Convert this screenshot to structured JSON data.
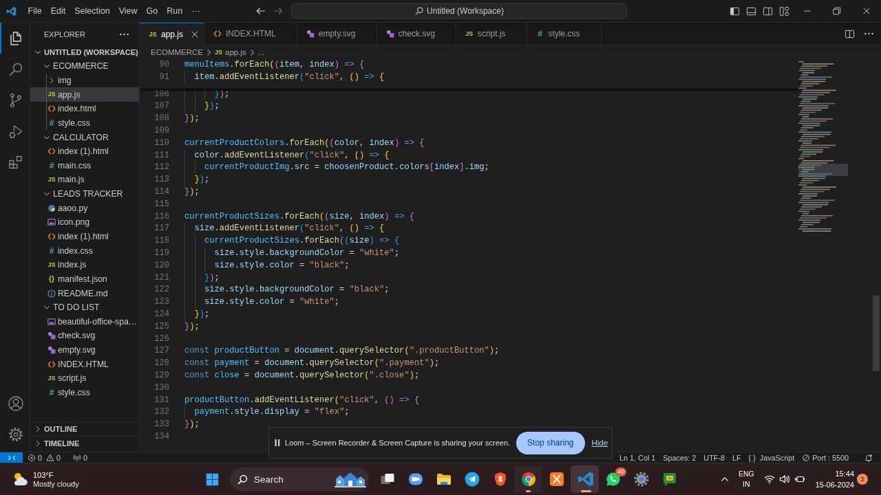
{
  "title_bar": {
    "menu": [
      "File",
      "Edit",
      "Selection",
      "View",
      "Go",
      "Run",
      "···"
    ],
    "command_center": "Untitled (Workspace)"
  },
  "activity_bar": {
    "top": [
      {
        "kind": "explorer",
        "selected": true
      },
      {
        "kind": "search",
        "selected": false
      },
      {
        "kind": "scm",
        "selected": false
      },
      {
        "kind": "debug",
        "selected": false
      },
      {
        "kind": "extensions",
        "selected": false
      }
    ],
    "bottom": [
      {
        "kind": "accounts"
      },
      {
        "kind": "manage"
      }
    ]
  },
  "sidebar": {
    "title": "EXPLORER",
    "sections": [
      {
        "title": "UNTITLED (WORKSPACE)",
        "expanded": true,
        "tree": [
          {
            "name": "ECOMMERCE",
            "kind": "folder",
            "expanded": true,
            "selected": false,
            "children": [
              {
                "name": "img",
                "kind": "folder",
                "expanded": false,
                "selected": false
              },
              {
                "name": "app.js",
                "kind": "js",
                "glyph": "JS",
                "selected": true
              },
              {
                "name": "index.html",
                "kind": "html",
                "selected": false
              },
              {
                "name": "style.css",
                "kind": "css",
                "glyph": "#",
                "selected": false
              }
            ]
          },
          {
            "name": "CALCULATOR",
            "kind": "folder",
            "expanded": true,
            "selected": false,
            "children": [
              {
                "name": "index (1).html",
                "kind": "html",
                "selected": false
              },
              {
                "name": "main.css",
                "kind": "css",
                "glyph": "#",
                "selected": false
              },
              {
                "name": "main.js",
                "kind": "js",
                "glyph": "JS",
                "selected": false
              }
            ]
          },
          {
            "name": "LEADS TRACKER",
            "kind": "folder",
            "expanded": true,
            "selected": false,
            "children": [
              {
                "name": "aaoo.py",
                "kind": "python",
                "selected": false
              },
              {
                "name": "icon.png",
                "kind": "image",
                "selected": false
              },
              {
                "name": "index (1).html",
                "kind": "html",
                "selected": false
              },
              {
                "name": "index.css",
                "kind": "css",
                "glyph": "#",
                "selected": false
              },
              {
                "name": "index.js",
                "kind": "js",
                "glyph": "JS",
                "selected": false
              },
              {
                "name": "manifest.json",
                "kind": "json",
                "glyph": "{}",
                "selected": false
              },
              {
                "name": "README.md",
                "kind": "markdown",
                "selected": false
              }
            ]
          },
          {
            "name": "TO DO LIST",
            "kind": "folder",
            "expanded": true,
            "selected": false,
            "children": [
              {
                "name": "beautiful-office-spa…",
                "kind": "image",
                "selected": false
              },
              {
                "name": "check.svg",
                "kind": "svg",
                "selected": false
              },
              {
                "name": "empty.svg",
                "kind": "svg",
                "selected": false
              },
              {
                "name": "INDEX.HTML",
                "kind": "html",
                "selected": false
              },
              {
                "name": "script.js",
                "kind": "js",
                "glyph": "JS",
                "selected": false
              },
              {
                "name": "style.css",
                "kind": "css",
                "glyph": "#",
                "selected": false
              }
            ]
          }
        ]
      },
      {
        "title": "OUTLINE",
        "expanded": false
      },
      {
        "title": "TIMELINE",
        "expanded": false
      }
    ]
  },
  "tabs": [
    {
      "label": "app.js",
      "kind": "js",
      "glyph": "JS",
      "selected": true
    },
    {
      "label": "INDEX.HTML",
      "kind": "html",
      "selected": false
    },
    {
      "label": "empty.svg",
      "kind": "svg",
      "selected": false
    },
    {
      "label": "check.svg",
      "kind": "svg",
      "selected": false
    },
    {
      "label": "script.js",
      "kind": "js",
      "glyph": "JS",
      "selected": false
    },
    {
      "label": "style.css",
      "kind": "css",
      "glyph": "#",
      "selected": false
    }
  ],
  "breadcrumbs": [
    {
      "label": "ECOMMERCE"
    },
    {
      "label": "app.js",
      "kind": "js",
      "glyph": "JS"
    },
    {
      "label": "..."
    }
  ],
  "editor": {
    "sticky_lines": [
      {
        "number": "90",
        "tokens": [
          {
            "kind": "const",
            "text": "menuItems"
          },
          {
            "kind": "plain",
            "text": "."
          },
          {
            "kind": "func",
            "text": "forEach"
          },
          {
            "kind": "bracket1",
            "text": "("
          },
          {
            "kind": "bracket2",
            "text": "("
          },
          {
            "kind": "var",
            "text": "item"
          },
          {
            "kind": "plain",
            "text": ", "
          },
          {
            "kind": "var",
            "text": "index"
          },
          {
            "kind": "bracket2",
            "text": ")"
          },
          {
            "kind": "keyword",
            "text": " => "
          },
          {
            "kind": "bracket2",
            "text": "{"
          }
        ]
      },
      {
        "number": "91",
        "tokens": [
          {
            "kind": "var",
            "text": "  item"
          },
          {
            "kind": "plain",
            "text": "."
          },
          {
            "kind": "func",
            "text": "addEventListener"
          },
          {
            "kind": "bracket3",
            "text": "("
          },
          {
            "kind": "string",
            "text": "\"click\""
          },
          {
            "kind": "plain",
            "text": ", "
          },
          {
            "kind": "bracket1",
            "text": "()"
          },
          {
            "kind": "keyword",
            "text": " => "
          },
          {
            "kind": "bracket1",
            "text": "{"
          }
        ]
      }
    ],
    "lines": [
      {
        "number": "106",
        "tokens": [
          {
            "kind": "bracket3",
            "text": "      }"
          },
          {
            "kind": "bracket2",
            "text": ")"
          },
          {
            "kind": "plain",
            "text": ";"
          }
        ]
      },
      {
        "number": "107",
        "tokens": [
          {
            "kind": "bracket1",
            "text": "    }"
          },
          {
            "kind": "bracket3",
            "text": ")"
          },
          {
            "kind": "plain",
            "text": ";"
          }
        ]
      },
      {
        "number": "108",
        "tokens": [
          {
            "kind": "bracket2",
            "text": "}"
          },
          {
            "kind": "bracket1",
            "text": ")"
          },
          {
            "kind": "plain",
            "text": ";"
          }
        ]
      },
      {
        "number": "109"
      },
      {
        "number": "110",
        "tokens": [
          {
            "kind": "const",
            "text": "currentProductColors"
          },
          {
            "kind": "plain",
            "text": "."
          },
          {
            "kind": "func",
            "text": "forEach"
          },
          {
            "kind": "bracket1",
            "text": "("
          },
          {
            "kind": "bracket2",
            "text": "("
          },
          {
            "kind": "var",
            "text": "color"
          },
          {
            "kind": "plain",
            "text": ", "
          },
          {
            "kind": "var",
            "text": "index"
          },
          {
            "kind": "bracket2",
            "text": ")"
          },
          {
            "kind": "keyword",
            "text": " => "
          },
          {
            "kind": "bracket2",
            "text": "{"
          }
        ]
      },
      {
        "number": "111",
        "tokens": [
          {
            "kind": "var",
            "text": "  color"
          },
          {
            "kind": "plain",
            "text": "."
          },
          {
            "kind": "func",
            "text": "addEventListener"
          },
          {
            "kind": "bracket3",
            "text": "("
          },
          {
            "kind": "string",
            "text": "\"click\""
          },
          {
            "kind": "plain",
            "text": ", "
          },
          {
            "kind": "bracket1",
            "text": "()"
          },
          {
            "kind": "keyword",
            "text": " => "
          },
          {
            "kind": "bracket1",
            "text": "{"
          }
        ]
      },
      {
        "number": "112",
        "tokens": [
          {
            "kind": "const",
            "text": "    currentProductImg"
          },
          {
            "kind": "plain",
            "text": "."
          },
          {
            "kind": "var",
            "text": "src"
          },
          {
            "kind": "plain",
            "text": " = "
          },
          {
            "kind": "var",
            "text": "choosenProduct"
          },
          {
            "kind": "plain",
            "text": "."
          },
          {
            "kind": "var",
            "text": "colors"
          },
          {
            "kind": "bracket2",
            "text": "["
          },
          {
            "kind": "var",
            "text": "index"
          },
          {
            "kind": "bracket2",
            "text": "]"
          },
          {
            "kind": "plain",
            "text": "."
          },
          {
            "kind": "var",
            "text": "img"
          },
          {
            "kind": "plain",
            "text": ";"
          }
        ]
      },
      {
        "number": "113",
        "tokens": [
          {
            "kind": "bracket1",
            "text": "  }"
          },
          {
            "kind": "bracket3",
            "text": ")"
          },
          {
            "kind": "plain",
            "text": ";"
          }
        ]
      },
      {
        "number": "114",
        "tokens": [
          {
            "kind": "bracket2",
            "text": "}"
          },
          {
            "kind": "bracket1",
            "text": ")"
          },
          {
            "kind": "plain",
            "text": ";"
          }
        ]
      },
      {
        "number": "115"
      },
      {
        "number": "116",
        "tokens": [
          {
            "kind": "const",
            "text": "currentProductSizes"
          },
          {
            "kind": "plain",
            "text": "."
          },
          {
            "kind": "func",
            "text": "forEach"
          },
          {
            "kind": "bracket1",
            "text": "("
          },
          {
            "kind": "bracket2",
            "text": "("
          },
          {
            "kind": "var",
            "text": "size"
          },
          {
            "kind": "plain",
            "text": ", "
          },
          {
            "kind": "var",
            "text": "index"
          },
          {
            "kind": "bracket2",
            "text": ")"
          },
          {
            "kind": "keyword",
            "text": " => "
          },
          {
            "kind": "bracket2",
            "text": "{"
          }
        ]
      },
      {
        "number": "117",
        "tokens": [
          {
            "kind": "var",
            "text": "  size"
          },
          {
            "kind": "plain",
            "text": "."
          },
          {
            "kind": "func",
            "text": "addEventListener"
          },
          {
            "kind": "bracket3",
            "text": "("
          },
          {
            "kind": "string",
            "text": "\"click\""
          },
          {
            "kind": "plain",
            "text": ", "
          },
          {
            "kind": "bracket1",
            "text": "()"
          },
          {
            "kind": "keyword",
            "text": " => "
          },
          {
            "kind": "bracket1",
            "text": "{"
          }
        ]
      },
      {
        "number": "118",
        "tokens": [
          {
            "kind": "const",
            "text": "    currentProductSizes"
          },
          {
            "kind": "plain",
            "text": "."
          },
          {
            "kind": "func",
            "text": "forEach"
          },
          {
            "kind": "bracket2",
            "text": "("
          },
          {
            "kind": "bracket3",
            "text": "("
          },
          {
            "kind": "var",
            "text": "size"
          },
          {
            "kind": "bracket3",
            "text": ")"
          },
          {
            "kind": "keyword",
            "text": " => "
          },
          {
            "kind": "bracket3",
            "text": "{"
          }
        ]
      },
      {
        "number": "119",
        "tokens": [
          {
            "kind": "var",
            "text": "      size"
          },
          {
            "kind": "plain",
            "text": "."
          },
          {
            "kind": "var",
            "text": "style"
          },
          {
            "kind": "plain",
            "text": "."
          },
          {
            "kind": "var",
            "text": "backgroundColor"
          },
          {
            "kind": "plain",
            "text": " = "
          },
          {
            "kind": "string",
            "text": "\"white\""
          },
          {
            "kind": "plain",
            "text": ";"
          }
        ]
      },
      {
        "number": "120",
        "tokens": [
          {
            "kind": "var",
            "text": "      size"
          },
          {
            "kind": "plain",
            "text": "."
          },
          {
            "kind": "var",
            "text": "style"
          },
          {
            "kind": "plain",
            "text": "."
          },
          {
            "kind": "var",
            "text": "color"
          },
          {
            "kind": "plain",
            "text": " = "
          },
          {
            "kind": "string",
            "text": "\"black\""
          },
          {
            "kind": "plain",
            "text": ";"
          }
        ]
      },
      {
        "number": "121",
        "tokens": [
          {
            "kind": "bracket3",
            "text": "    }"
          },
          {
            "kind": "bracket2",
            "text": ")"
          },
          {
            "kind": "plain",
            "text": ";"
          }
        ]
      },
      {
        "number": "122",
        "tokens": [
          {
            "kind": "var",
            "text": "    size"
          },
          {
            "kind": "plain",
            "text": "."
          },
          {
            "kind": "var",
            "text": "style"
          },
          {
            "kind": "plain",
            "text": "."
          },
          {
            "kind": "var",
            "text": "backgroundColor"
          },
          {
            "kind": "plain",
            "text": " = "
          },
          {
            "kind": "string",
            "text": "\"black\""
          },
          {
            "kind": "plain",
            "text": ";"
          }
        ]
      },
      {
        "number": "123",
        "tokens": [
          {
            "kind": "var",
            "text": "    size"
          },
          {
            "kind": "plain",
            "text": "."
          },
          {
            "kind": "var",
            "text": "style"
          },
          {
            "kind": "plain",
            "text": "."
          },
          {
            "kind": "var",
            "text": "color"
          },
          {
            "kind": "plain",
            "text": " = "
          },
          {
            "kind": "string",
            "text": "\"white\""
          },
          {
            "kind": "plain",
            "text": ";"
          }
        ]
      },
      {
        "number": "124",
        "tokens": [
          {
            "kind": "bracket1",
            "text": "  }"
          },
          {
            "kind": "bracket3",
            "text": ")"
          },
          {
            "kind": "plain",
            "text": ";"
          }
        ]
      },
      {
        "number": "125",
        "tokens": [
          {
            "kind": "bracket2",
            "text": "}"
          },
          {
            "kind": "bracket1",
            "text": ")"
          },
          {
            "kind": "plain",
            "text": ";"
          }
        ]
      },
      {
        "number": "126"
      },
      {
        "number": "127",
        "tokens": [
          {
            "kind": "keyword",
            "text": "const "
          },
          {
            "kind": "const",
            "text": "productButton"
          },
          {
            "kind": "plain",
            "text": " = "
          },
          {
            "kind": "var",
            "text": "document"
          },
          {
            "kind": "plain",
            "text": "."
          },
          {
            "kind": "func",
            "text": "querySelector"
          },
          {
            "kind": "bracket1",
            "text": "("
          },
          {
            "kind": "string",
            "text": "\".productButton\""
          },
          {
            "kind": "bracket1",
            "text": ")"
          },
          {
            "kind": "plain",
            "text": ";"
          }
        ]
      },
      {
        "number": "128",
        "tokens": [
          {
            "kind": "keyword",
            "text": "const "
          },
          {
            "kind": "const",
            "text": "payment"
          },
          {
            "kind": "plain",
            "text": " = "
          },
          {
            "kind": "var",
            "text": "document"
          },
          {
            "kind": "plain",
            "text": "."
          },
          {
            "kind": "func",
            "text": "querySelector"
          },
          {
            "kind": "bracket1",
            "text": "("
          },
          {
            "kind": "string",
            "text": "\".payment\""
          },
          {
            "kind": "bracket1",
            "text": ")"
          },
          {
            "kind": "plain",
            "text": ";"
          }
        ]
      },
      {
        "number": "129",
        "tokens": [
          {
            "kind": "keyword",
            "text": "const "
          },
          {
            "kind": "const",
            "text": "close"
          },
          {
            "kind": "plain",
            "text": " = "
          },
          {
            "kind": "var",
            "text": "document"
          },
          {
            "kind": "plain",
            "text": "."
          },
          {
            "kind": "func",
            "text": "querySelector"
          },
          {
            "kind": "bracket1",
            "text": "("
          },
          {
            "kind": "string",
            "text": "\".close\""
          },
          {
            "kind": "bracket1",
            "text": ")"
          },
          {
            "kind": "plain",
            "text": ";"
          }
        ]
      },
      {
        "number": "130"
      },
      {
        "number": "131",
        "tokens": [
          {
            "kind": "const",
            "text": "productButton"
          },
          {
            "kind": "plain",
            "text": "."
          },
          {
            "kind": "func",
            "text": "addEventListener"
          },
          {
            "kind": "bracket1",
            "text": "("
          },
          {
            "kind": "string",
            "text": "\"click\""
          },
          {
            "kind": "plain",
            "text": ", "
          },
          {
            "kind": "bracket2",
            "text": "()"
          },
          {
            "kind": "keyword",
            "text": " => "
          },
          {
            "kind": "bracket2",
            "text": "{"
          }
        ]
      },
      {
        "number": "132",
        "tokens": [
          {
            "kind": "const",
            "text": "  payment"
          },
          {
            "kind": "plain",
            "text": "."
          },
          {
            "kind": "var",
            "text": "style"
          },
          {
            "kind": "plain",
            "text": "."
          },
          {
            "kind": "var",
            "text": "display"
          },
          {
            "kind": "plain",
            "text": " = "
          },
          {
            "kind": "string",
            "text": "\"flex\""
          },
          {
            "kind": "plain",
            "text": ";"
          }
        ]
      },
      {
        "number": "133",
        "tokens": [
          {
            "kind": "bracket2",
            "text": "}"
          },
          {
            "kind": "bracket1",
            "text": ")"
          },
          {
            "kind": "plain",
            "text": ";"
          }
        ]
      },
      {
        "number": "134"
      }
    ]
  },
  "share_banner": {
    "message": "Loom – Screen Recorder & Screen Capture is sharing your screen.",
    "stop_button": "Stop sharing",
    "hide_link": "Hide"
  },
  "status_bar": {
    "errors": "0",
    "warnings": "0",
    "ports": "0",
    "items": [
      "Ln 1, Col 1",
      "Spaces: 2",
      "UTF-8",
      "LF"
    ],
    "language": {
      "glyph": "{ }",
      "label": "JavaScript"
    },
    "live_server": "Port : 5500"
  },
  "taskbar": {
    "weather": {
      "temperature": "103°F",
      "condition": "Mostly cloudy"
    },
    "search": {
      "placeholder": "Search"
    },
    "apps": [
      {
        "kind": "taskview",
        "running": false,
        "active": false
      },
      {
        "kind": "meet",
        "running": false,
        "active": false
      },
      {
        "kind": "files",
        "running": false,
        "active": false
      },
      {
        "kind": "telegram",
        "running": false,
        "active": false
      },
      {
        "kind": "brave",
        "running": false,
        "active": false
      },
      {
        "kind": "chrome",
        "running": true,
        "active": false
      },
      {
        "kind": "xampp",
        "running": false,
        "active": false
      },
      {
        "kind": "vscode",
        "running": true,
        "active": true
      },
      {
        "kind": "whatsapp",
        "running": false,
        "active": false,
        "badge": "40"
      },
      {
        "kind": "settings",
        "running": false,
        "active": false
      },
      {
        "kind": "chat",
        "running": false,
        "active": false
      }
    ],
    "tray": {
      "language": "ENG",
      "region": "IN"
    },
    "clock": {
      "time": "15:44",
      "date": "15-06-2024"
    },
    "notifications": "3"
  }
}
